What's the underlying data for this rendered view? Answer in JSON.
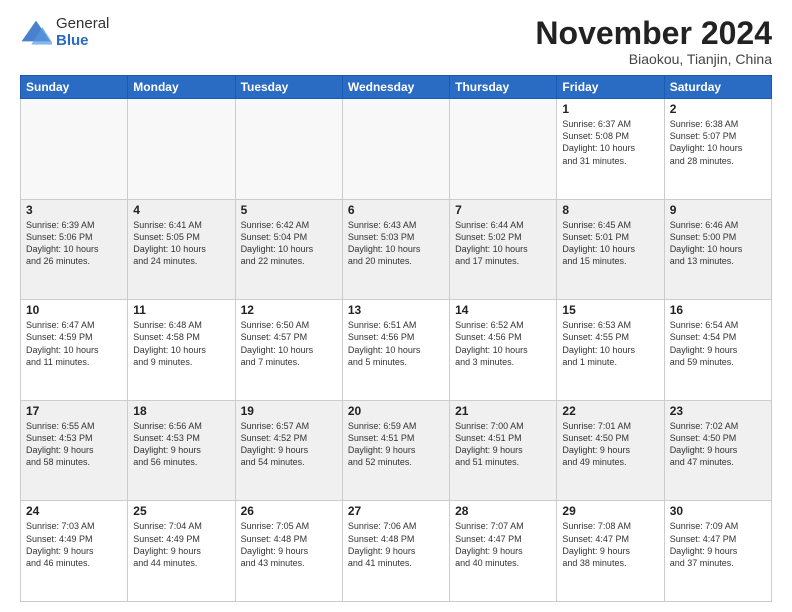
{
  "logo": {
    "general": "General",
    "blue": "Blue"
  },
  "title": "November 2024",
  "location": "Biaokou, Tianjin, China",
  "weekdays": [
    "Sunday",
    "Monday",
    "Tuesday",
    "Wednesday",
    "Thursday",
    "Friday",
    "Saturday"
  ],
  "weeks": [
    [
      {
        "day": "",
        "info": ""
      },
      {
        "day": "",
        "info": ""
      },
      {
        "day": "",
        "info": ""
      },
      {
        "day": "",
        "info": ""
      },
      {
        "day": "",
        "info": ""
      },
      {
        "day": "1",
        "info": "Sunrise: 6:37 AM\nSunset: 5:08 PM\nDaylight: 10 hours\nand 31 minutes."
      },
      {
        "day": "2",
        "info": "Sunrise: 6:38 AM\nSunset: 5:07 PM\nDaylight: 10 hours\nand 28 minutes."
      }
    ],
    [
      {
        "day": "3",
        "info": "Sunrise: 6:39 AM\nSunset: 5:06 PM\nDaylight: 10 hours\nand 26 minutes."
      },
      {
        "day": "4",
        "info": "Sunrise: 6:41 AM\nSunset: 5:05 PM\nDaylight: 10 hours\nand 24 minutes."
      },
      {
        "day": "5",
        "info": "Sunrise: 6:42 AM\nSunset: 5:04 PM\nDaylight: 10 hours\nand 22 minutes."
      },
      {
        "day": "6",
        "info": "Sunrise: 6:43 AM\nSunset: 5:03 PM\nDaylight: 10 hours\nand 20 minutes."
      },
      {
        "day": "7",
        "info": "Sunrise: 6:44 AM\nSunset: 5:02 PM\nDaylight: 10 hours\nand 17 minutes."
      },
      {
        "day": "8",
        "info": "Sunrise: 6:45 AM\nSunset: 5:01 PM\nDaylight: 10 hours\nand 15 minutes."
      },
      {
        "day": "9",
        "info": "Sunrise: 6:46 AM\nSunset: 5:00 PM\nDaylight: 10 hours\nand 13 minutes."
      }
    ],
    [
      {
        "day": "10",
        "info": "Sunrise: 6:47 AM\nSunset: 4:59 PM\nDaylight: 10 hours\nand 11 minutes."
      },
      {
        "day": "11",
        "info": "Sunrise: 6:48 AM\nSunset: 4:58 PM\nDaylight: 10 hours\nand 9 minutes."
      },
      {
        "day": "12",
        "info": "Sunrise: 6:50 AM\nSunset: 4:57 PM\nDaylight: 10 hours\nand 7 minutes."
      },
      {
        "day": "13",
        "info": "Sunrise: 6:51 AM\nSunset: 4:56 PM\nDaylight: 10 hours\nand 5 minutes."
      },
      {
        "day": "14",
        "info": "Sunrise: 6:52 AM\nSunset: 4:56 PM\nDaylight: 10 hours\nand 3 minutes."
      },
      {
        "day": "15",
        "info": "Sunrise: 6:53 AM\nSunset: 4:55 PM\nDaylight: 10 hours\nand 1 minute."
      },
      {
        "day": "16",
        "info": "Sunrise: 6:54 AM\nSunset: 4:54 PM\nDaylight: 9 hours\nand 59 minutes."
      }
    ],
    [
      {
        "day": "17",
        "info": "Sunrise: 6:55 AM\nSunset: 4:53 PM\nDaylight: 9 hours\nand 58 minutes."
      },
      {
        "day": "18",
        "info": "Sunrise: 6:56 AM\nSunset: 4:53 PM\nDaylight: 9 hours\nand 56 minutes."
      },
      {
        "day": "19",
        "info": "Sunrise: 6:57 AM\nSunset: 4:52 PM\nDaylight: 9 hours\nand 54 minutes."
      },
      {
        "day": "20",
        "info": "Sunrise: 6:59 AM\nSunset: 4:51 PM\nDaylight: 9 hours\nand 52 minutes."
      },
      {
        "day": "21",
        "info": "Sunrise: 7:00 AM\nSunset: 4:51 PM\nDaylight: 9 hours\nand 51 minutes."
      },
      {
        "day": "22",
        "info": "Sunrise: 7:01 AM\nSunset: 4:50 PM\nDaylight: 9 hours\nand 49 minutes."
      },
      {
        "day": "23",
        "info": "Sunrise: 7:02 AM\nSunset: 4:50 PM\nDaylight: 9 hours\nand 47 minutes."
      }
    ],
    [
      {
        "day": "24",
        "info": "Sunrise: 7:03 AM\nSunset: 4:49 PM\nDaylight: 9 hours\nand 46 minutes."
      },
      {
        "day": "25",
        "info": "Sunrise: 7:04 AM\nSunset: 4:49 PM\nDaylight: 9 hours\nand 44 minutes."
      },
      {
        "day": "26",
        "info": "Sunrise: 7:05 AM\nSunset: 4:48 PM\nDaylight: 9 hours\nand 43 minutes."
      },
      {
        "day": "27",
        "info": "Sunrise: 7:06 AM\nSunset: 4:48 PM\nDaylight: 9 hours\nand 41 minutes."
      },
      {
        "day": "28",
        "info": "Sunrise: 7:07 AM\nSunset: 4:47 PM\nDaylight: 9 hours\nand 40 minutes."
      },
      {
        "day": "29",
        "info": "Sunrise: 7:08 AM\nSunset: 4:47 PM\nDaylight: 9 hours\nand 38 minutes."
      },
      {
        "day": "30",
        "info": "Sunrise: 7:09 AM\nSunset: 4:47 PM\nDaylight: 9 hours\nand 37 minutes."
      }
    ]
  ]
}
